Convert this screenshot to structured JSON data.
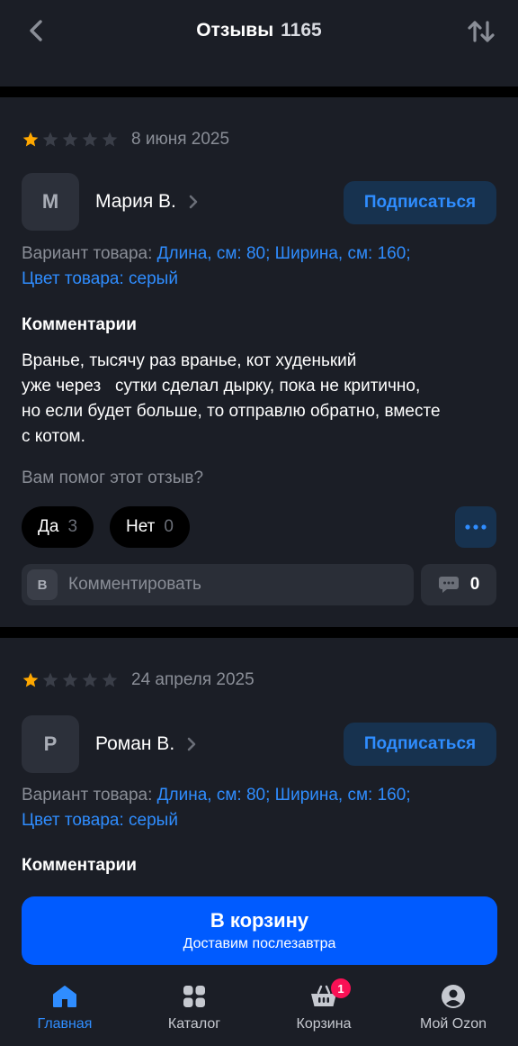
{
  "header": {
    "title": "Отзывы",
    "count": "1165"
  },
  "reviews": [
    {
      "rating": 1,
      "date": "8 июня 2025",
      "avatar_letter": "М",
      "author": "Мария В.",
      "subscribe_label": "Подписаться",
      "variant_prefix": "Вариант товара:",
      "variant_value_1": "Длина, см: 80; Ширина, см: 160;",
      "variant_value_2": "Цвет товара: серый",
      "comments_title": "Комментарии",
      "text_lines": [
        "Вранье, тысячу раз вранье, кот худенький",
        "уже через   сутки сделал дырку, пока не критично,",
        "но если будет больше, то отправлю обратно, вместе",
        "с котом."
      ],
      "helpful_question": "Вам помог этот отзыв?",
      "yes_label": "Да",
      "yes_count": "3",
      "no_label": "Нет",
      "no_count": "0",
      "comment_avatar_letter": "В",
      "comment_placeholder": "Комментировать",
      "comment_count": "0"
    },
    {
      "rating": 1,
      "date": "24 апреля 2025",
      "avatar_letter": "Р",
      "author": "Роман В.",
      "subscribe_label": "Подписаться",
      "variant_prefix": "Вариант товара:",
      "variant_value_1": "Длина, см: 80; Ширина, см: 160;",
      "variant_value_2": "Цвет товара: серый",
      "comments_title": "Комментарии"
    }
  ],
  "cart": {
    "label": "В корзину",
    "delivery": "Доставим послезавтра"
  },
  "tabbar": {
    "items": [
      {
        "label": "Главная",
        "icon": "home-icon",
        "active": true
      },
      {
        "label": "Каталог",
        "icon": "catalog-icon",
        "active": false
      },
      {
        "label": "Корзина",
        "icon": "basket-icon",
        "active": false,
        "badge": "1"
      },
      {
        "label": "Мой Ozon",
        "icon": "profile-icon",
        "active": false
      }
    ]
  },
  "colors": {
    "background": "#1b1e26",
    "accent": "#005bff",
    "link": "#2f8dff",
    "star": "#ffa800",
    "badge": "#f91155"
  }
}
